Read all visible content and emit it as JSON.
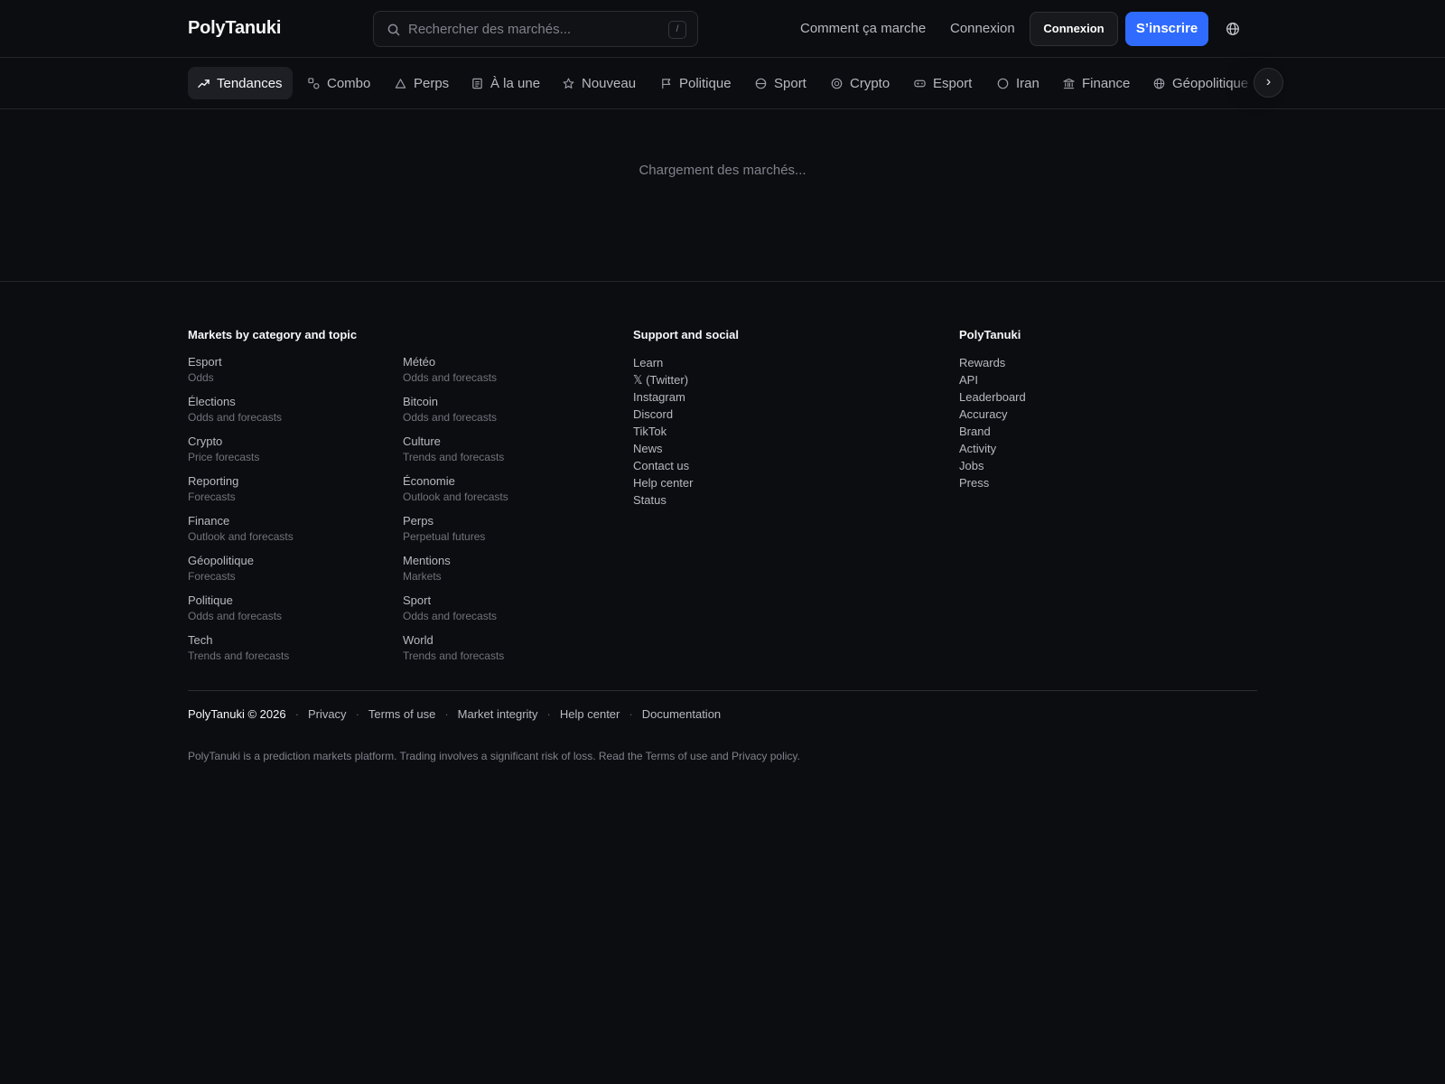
{
  "header": {
    "logo": "PolyTanuki",
    "search_placeholder": "Rechercher des marchés...",
    "search_shortcut": "/",
    "how_it_works": "Comment ça marche",
    "login_link": "Connexion",
    "login_button": "Connexion",
    "signup_button": "S’inscrire",
    "language_icon": "globe-icon"
  },
  "categories": [
    {
      "label": "Tendances",
      "icon": "trending-icon",
      "active": true
    },
    {
      "label": "Combo",
      "icon": "combo-icon"
    },
    {
      "label": "Perps",
      "icon": "triangle-icon"
    },
    {
      "label": "À la une",
      "icon": "newspaper-icon"
    },
    {
      "label": "Nouveau",
      "icon": "star-icon"
    },
    {
      "label": "Politique",
      "icon": "flag-icon"
    },
    {
      "label": "Sport",
      "icon": "ball-icon"
    },
    {
      "label": "Crypto",
      "icon": "coin-icon"
    },
    {
      "label": "Esport",
      "icon": "gamepad-icon"
    },
    {
      "label": "Iran",
      "icon": "circle-icon"
    },
    {
      "label": "Finance",
      "icon": "bank-icon"
    },
    {
      "label": "Géopolitique",
      "icon": "globe-icon"
    }
  ],
  "main": {
    "loading_text": "Chargement des marchés..."
  },
  "footer": {
    "markets_heading": "Markets by category and topic",
    "markets_col1": [
      {
        "name": "Esport",
        "sub": "Odds"
      },
      {
        "name": "Élections",
        "sub": "Odds and forecasts"
      },
      {
        "name": "Crypto",
        "sub": "Price forecasts"
      },
      {
        "name": "Reporting",
        "sub": "Forecasts"
      },
      {
        "name": "Finance",
        "sub": "Outlook and forecasts"
      },
      {
        "name": "Géopolitique",
        "sub": "Forecasts"
      },
      {
        "name": "Politique",
        "sub": "Odds and forecasts"
      },
      {
        "name": "Tech",
        "sub": "Trends and forecasts"
      }
    ],
    "markets_col2": [
      {
        "name": "Météo",
        "sub": "Odds and forecasts"
      },
      {
        "name": "Bitcoin",
        "sub": "Odds and forecasts"
      },
      {
        "name": "Culture",
        "sub": "Trends and forecasts"
      },
      {
        "name": "Économie",
        "sub": "Outlook and forecasts"
      },
      {
        "name": "Perps",
        "sub": "Perpetual futures"
      },
      {
        "name": "Mentions",
        "sub": "Markets"
      },
      {
        "name": "Sport",
        "sub": "Odds and forecasts"
      },
      {
        "name": "World",
        "sub": "Trends and forecasts"
      }
    ],
    "support_heading": "Support and social",
    "support_links": [
      "Learn",
      "𝕏 (Twitter)",
      "Instagram",
      "Discord",
      "TikTok",
      "News",
      "Contact us",
      "Help center",
      "Status"
    ],
    "brand_heading": "PolyTanuki",
    "brand_links": [
      "Rewards",
      "API",
      "Leaderboard",
      "Accuracy",
      "Brand",
      "Activity",
      "Jobs",
      "Press"
    ],
    "copyright": "PolyTanuki © 2026",
    "legal_links": [
      "Privacy",
      "Terms of use",
      "Market integrity",
      "Help center",
      "Documentation"
    ],
    "disclaimer": "PolyTanuki is a prediction markets platform. Trading involves a significant risk of loss. Read the Terms of use and Privacy policy."
  },
  "colors": {
    "background": "#0c0d10",
    "accent": "#2f6bff",
    "border": "#23252b"
  }
}
